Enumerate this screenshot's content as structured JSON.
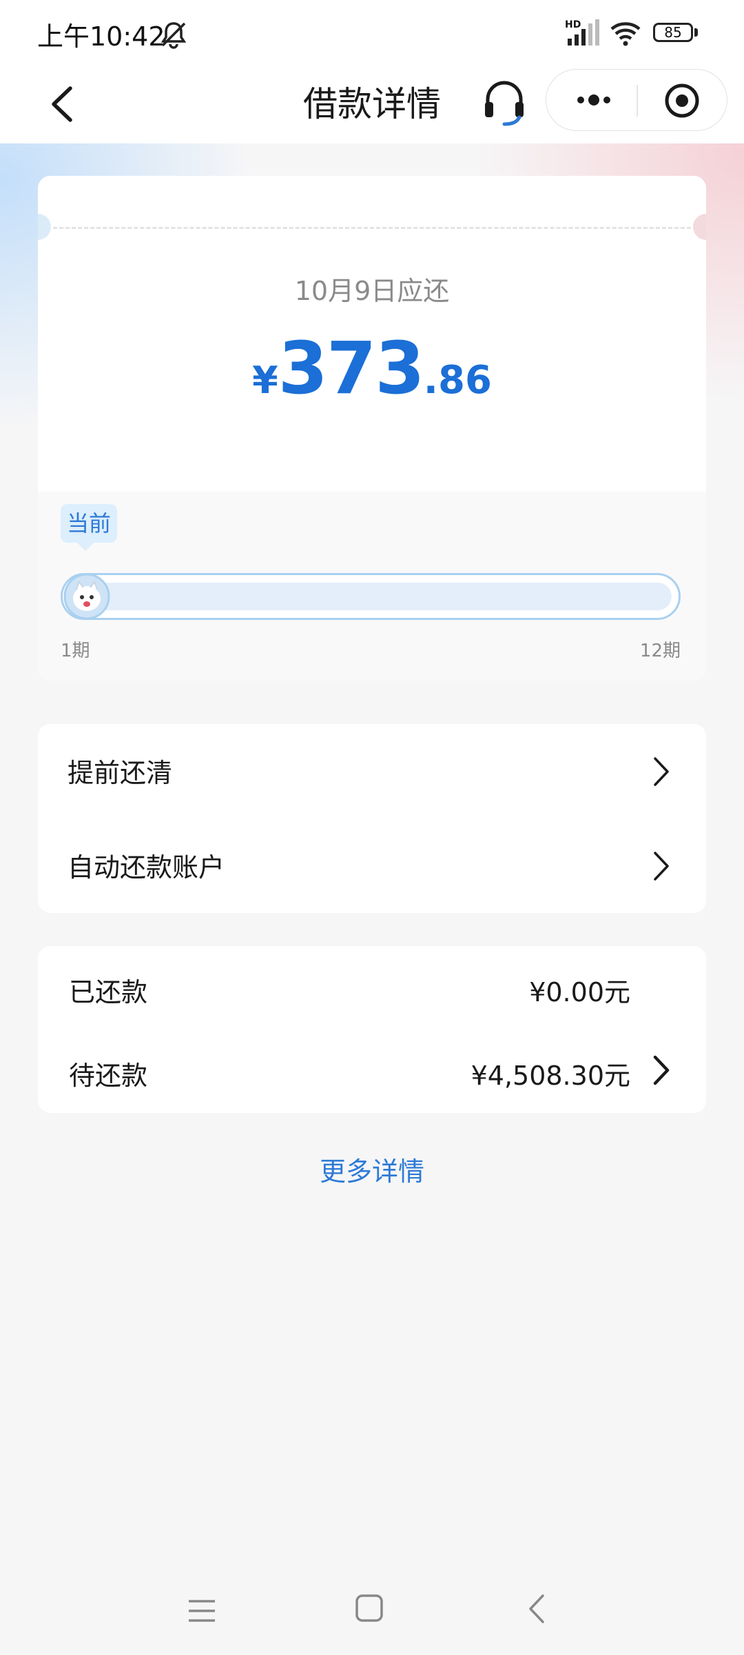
{
  "status_bar": {
    "time": "上午10:42",
    "network_label": "HD",
    "battery": "85"
  },
  "nav": {
    "title": "借款详情"
  },
  "bill": {
    "due_label": "10月9日应还",
    "currency": "¥",
    "amount_int": "373",
    "amount_dec": ".86",
    "current_tag": "当前",
    "period_start": "1期",
    "period_end": "12期",
    "progress_fraction": 0.0833
  },
  "menu": {
    "items": [
      {
        "label": "提前还清"
      },
      {
        "label": "自动还款账户"
      }
    ]
  },
  "payments": {
    "paid_label": "已还款",
    "paid_value": "¥0.00元",
    "pending_label": "待还款",
    "pending_value": "¥4,508.30元"
  },
  "more_details": "更多详情",
  "colors": {
    "accent": "#1b6fd6",
    "link": "#2d7ad6"
  }
}
